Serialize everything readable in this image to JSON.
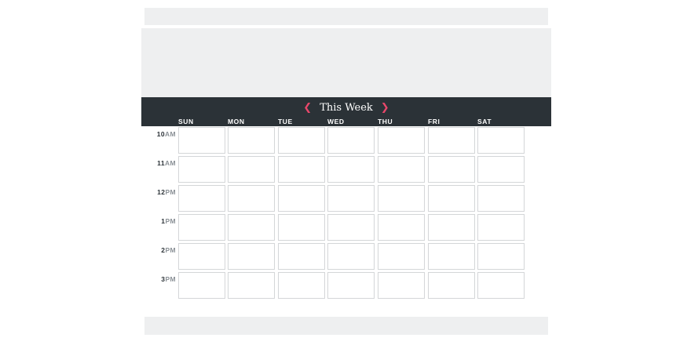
{
  "calendar": {
    "title": "This Week",
    "prev_icon": "chevron-left-icon",
    "next_icon": "chevron-right-icon",
    "accent_color": "#e8476a",
    "header_color": "#2b3237",
    "days": [
      "SUN",
      "MON",
      "TUE",
      "WED",
      "THU",
      "FRI",
      "SAT"
    ],
    "times": [
      {
        "hour": "10",
        "ampm": "AM"
      },
      {
        "hour": "11",
        "ampm": "AM"
      },
      {
        "hour": "12",
        "ampm": "PM"
      },
      {
        "hour": "1",
        "ampm": "PM"
      },
      {
        "hour": "2",
        "ampm": "PM"
      },
      {
        "hour": "3",
        "ampm": "PM"
      }
    ]
  }
}
